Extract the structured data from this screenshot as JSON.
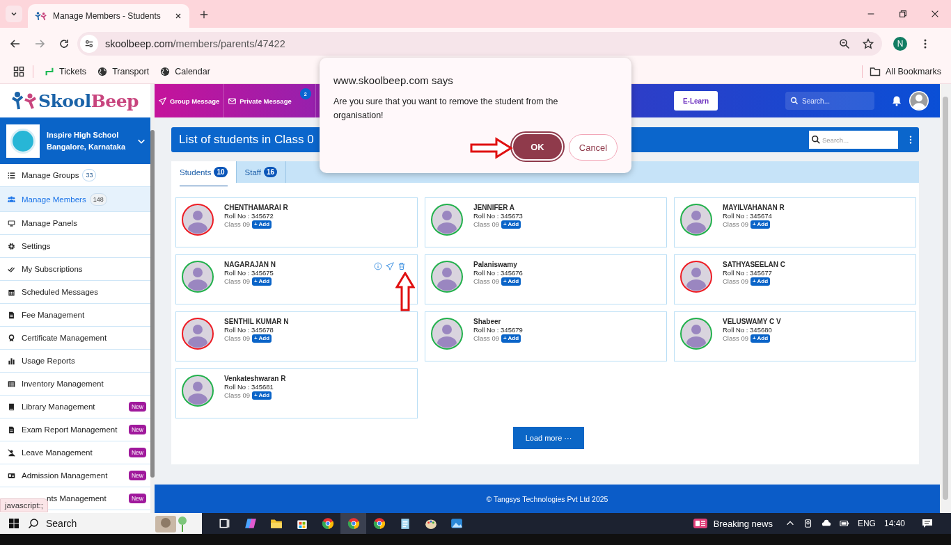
{
  "browser": {
    "tab": {
      "title": "Manage Members - Students"
    },
    "address": {
      "domain": "skoolbeep.com",
      "path": "/members/parents/47422"
    },
    "profile_initial": "N",
    "bookmarks": [
      {
        "label": "Tickets"
      },
      {
        "label": "Transport"
      },
      {
        "label": "Calendar"
      }
    ],
    "all_bookmarks": "All Bookmarks"
  },
  "app": {
    "logo": {
      "parts": [
        "Skool",
        "Beep"
      ]
    },
    "nav": [
      {
        "label": "Group Message",
        "kind": "send"
      },
      {
        "label": "Private Message",
        "kind": "mail",
        "badge": "2"
      },
      {
        "kind": "image"
      }
    ],
    "elearn": "E-Learn",
    "search": {
      "placeholder": "Search..."
    },
    "school": {
      "name": "Inspire High School",
      "location": "Bangalore, Karnataka"
    },
    "sidebar": {
      "items": [
        {
          "label": "Manage Groups",
          "count": "33",
          "selected": false
        },
        {
          "label": "Manage Members",
          "count": "148",
          "selected": true
        },
        {
          "label": "Manage Panels",
          "selected": false
        },
        {
          "label": "Settings",
          "selected": false
        },
        {
          "label": "My Subscriptions",
          "selected": false
        },
        {
          "label": "Scheduled Messages",
          "selected": false
        },
        {
          "label": "Fee Management",
          "selected": false
        },
        {
          "label": "Certificate Management",
          "selected": false
        },
        {
          "label": "Usage Reports",
          "selected": false
        },
        {
          "label": "Inventory Management",
          "selected": false
        },
        {
          "label": "Library Management",
          "badge": "New",
          "selected": false
        },
        {
          "label": "Exam Report Management",
          "badge": "New",
          "selected": false
        },
        {
          "label": "Leave Management",
          "badge": "New",
          "selected": false
        },
        {
          "label": "Admission Management",
          "badge": "New",
          "selected": false
        },
        {
          "label": "nts Management",
          "badge": "New",
          "selected": false
        }
      ]
    },
    "title": "List of students in Class 0",
    "list_search": {
      "placeholder": "Search..."
    },
    "tabs": [
      {
        "label": "Students",
        "count": "10",
        "selected": true
      },
      {
        "label": "Staff",
        "count": "16",
        "selected": false
      }
    ],
    "students": [
      {
        "name": "CHENTHAMARAI R",
        "roll": "Roll No : 345672",
        "class": "Class 09",
        "add": "+ Add",
        "color": "#ee1c24",
        "actions_shown": false
      },
      {
        "name": "JENNIFER A",
        "roll": "Roll No : 345673",
        "class": "Class 09",
        "add": "+ Add",
        "color": "#22b14c",
        "actions_shown": false
      },
      {
        "name": "MAYILVAHANAN R",
        "roll": "Roll No : 345674",
        "class": "Class 09",
        "add": "+ Add",
        "color": "#22b14c",
        "actions_shown": false
      },
      {
        "name": "NAGARAJAN N",
        "roll": "Roll No : 345675",
        "class": "Class 09",
        "add": "+ Add",
        "color": "#22b14c",
        "actions_shown": true
      },
      {
        "name": "Palaniswamy",
        "roll": "Roll No : 345676",
        "class": "Class 09",
        "add": "+ Add",
        "color": "#22b14c",
        "actions_shown": false
      },
      {
        "name": "SATHYASEELAN C",
        "roll": "Roll No : 345677",
        "class": "Class 09",
        "add": "+ Add",
        "color": "#ee1c24",
        "actions_shown": false
      },
      {
        "name": "SENTHIL KUMAR N",
        "roll": "Roll No : 345678",
        "class": "Class 09",
        "add": "+ Add",
        "color": "#ee1c24",
        "actions_shown": false
      },
      {
        "name": "Shabeer",
        "roll": "Roll No : 345679",
        "class": "Class 09",
        "add": "+ Add",
        "color": "#22b14c",
        "actions_shown": false
      },
      {
        "name": "VELUSWAMY C V",
        "roll": "Roll No : 345680",
        "class": "Class 09",
        "add": "+ Add",
        "color": "#22b14c",
        "actions_shown": false
      },
      {
        "name": "Venkateshwaran R",
        "roll": "Roll No : 345681",
        "class": "Class 09",
        "add": "+ Add",
        "color": "#22b14c",
        "actions_shown": false
      }
    ],
    "load_more": "Load more ···",
    "footer": "© Tangsys Technologies Pvt Ltd 2025"
  },
  "status_tooltip": "javascript:;",
  "dialog": {
    "title": "www.skoolbeep.com says",
    "message": "Are you sure that you want to remove the student from the organisation!",
    "buttons": [
      {
        "label": "OK",
        "kind": "primary"
      },
      {
        "label": "Cancel",
        "kind": "secondary"
      }
    ]
  },
  "taskbar": {
    "search": "Search",
    "news": "Breaking news",
    "language": "ENG",
    "time": "14:40"
  }
}
